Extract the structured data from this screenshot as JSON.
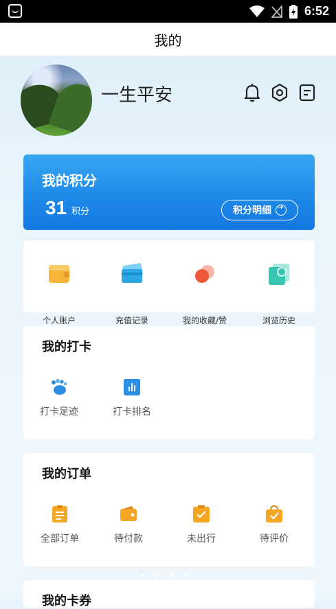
{
  "status": {
    "time": "6:52"
  },
  "header": {
    "title": "我的"
  },
  "profile": {
    "name": "一生平安"
  },
  "points": {
    "title": "我的积分",
    "value": "31",
    "unit": "积分",
    "detail_label": "积分明细"
  },
  "quick_links": [
    {
      "label": "个人账户",
      "icon": "wallet-icon",
      "color": "#f4a42b"
    },
    {
      "label": "充值记录",
      "icon": "card-icon",
      "color": "#2ba7e6"
    },
    {
      "label": "我的收藏/赞",
      "icon": "favorite-icon",
      "color": "#ee5a3a"
    },
    {
      "label": "浏览历史",
      "icon": "history-icon",
      "color": "#37c6b2"
    }
  ],
  "checkin": {
    "title": "我的打卡",
    "items": [
      {
        "label": "打卡足迹",
        "icon": "footprint-icon",
        "color": "#2d8fe3"
      },
      {
        "label": "打卡排名",
        "icon": "ranking-icon",
        "color": "#2d8fe3"
      }
    ]
  },
  "orders": {
    "title": "我的订单",
    "items": [
      {
        "label": "全部订单",
        "icon": "order-list-icon",
        "color": "#f5a623"
      },
      {
        "label": "待付款",
        "icon": "wallet-icon",
        "color": "#f5a623"
      },
      {
        "label": "未出行",
        "icon": "clipboard-check-icon",
        "color": "#f5a623"
      },
      {
        "label": "待评价",
        "icon": "bag-check-icon",
        "color": "#f5a623"
      }
    ]
  },
  "coupons": {
    "title": "我的卡券"
  }
}
